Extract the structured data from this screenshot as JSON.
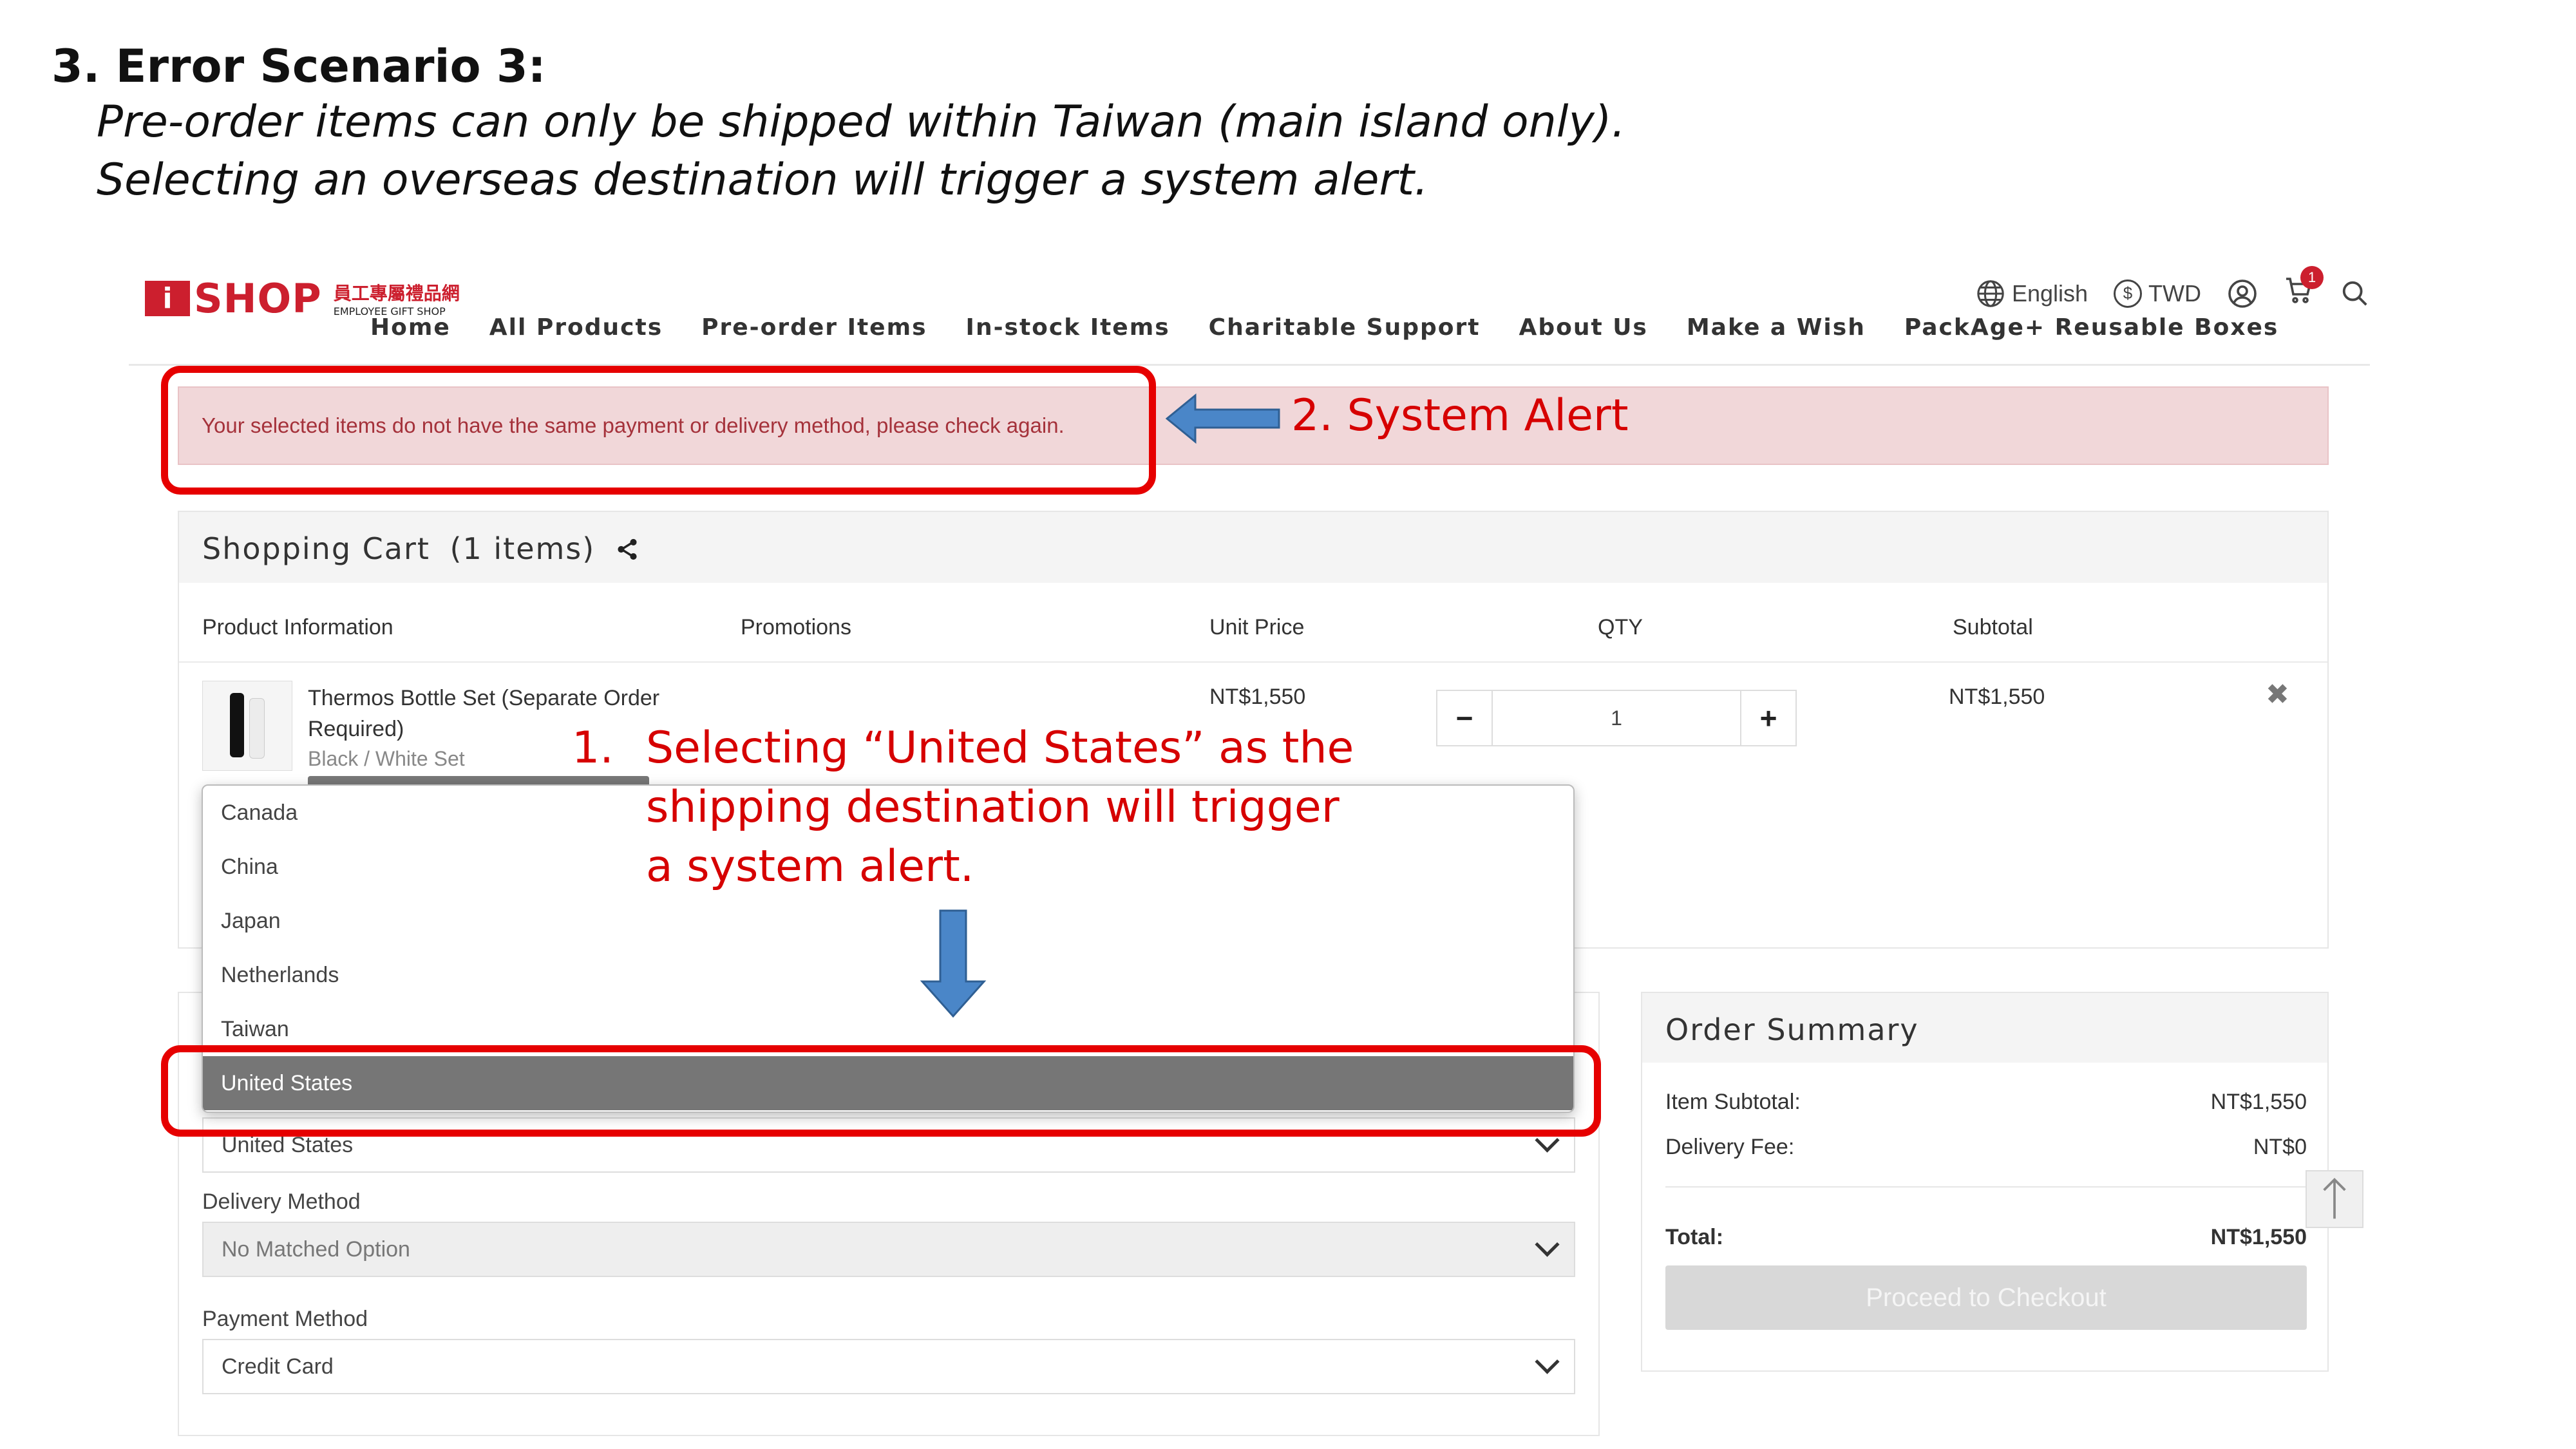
{
  "slide": {
    "title": "3. Error Scenario 3:",
    "line1": "Pre-order items can only be shipped within Taiwan (main island only).",
    "line2": "Selecting an overseas destination will trigger a system alert."
  },
  "header": {
    "logo_mark": "i",
    "logo_name": "SHOP",
    "logo_sub_cn": "員工專屬禮品網",
    "logo_sub_en": "EMPLOYEE GIFT SHOP",
    "nav": [
      "Home",
      "All Products",
      "Pre-order Items",
      "In-stock Items",
      "Charitable Support",
      "About Us",
      "Make a Wish",
      "PackAge+ Reusable Boxes"
    ],
    "language": "English",
    "currency": "TWD",
    "cart_count": "1",
    "icons": [
      "globe-icon",
      "dollar-icon",
      "user-icon",
      "cart-icon",
      "search-icon"
    ]
  },
  "alert": {
    "message": "Your selected items do not have the same payment or delivery method, please check again."
  },
  "cart": {
    "title": "Shopping Cart",
    "count": "(1 items)",
    "columns": [
      "Product Information",
      "Promotions",
      "Unit Price",
      "QTY",
      "Subtotal"
    ],
    "item": {
      "name": "Thermos Bottle Set (Separate Order Required)",
      "variant": "Black / White Set",
      "unit_price": "NT$1,550",
      "qty": "1",
      "subtotal": "NT$1,550"
    }
  },
  "shipping": {
    "destination_value": "United States",
    "delivery_label": "Delivery Method",
    "delivery_value": "No Matched Option",
    "payment_label": "Payment Method",
    "payment_value": "Credit Card"
  },
  "dropdown": {
    "options": [
      "Canada",
      "China",
      "Japan",
      "Netherlands",
      "Taiwan",
      "United States"
    ],
    "selected": "United States"
  },
  "summary": {
    "title": "Order Summary",
    "item_subtotal_label": "Item Subtotal:",
    "item_subtotal_value": "NT$1,550",
    "delivery_fee_label": "Delivery Fee:",
    "delivery_fee_value": "NT$0",
    "total_label": "Total:",
    "total_value": "NT$1,550",
    "checkout_label": "Proceed to Checkout"
  },
  "annotations": {
    "alert_label": "2.   System Alert",
    "step1_num": "1.",
    "step1_line1": "Selecting “United States” as the",
    "step1_line2": "shipping destination will trigger",
    "step1_line3": "a system alert.",
    "color": "#e60000",
    "arrow_color": "#4a86c8"
  }
}
